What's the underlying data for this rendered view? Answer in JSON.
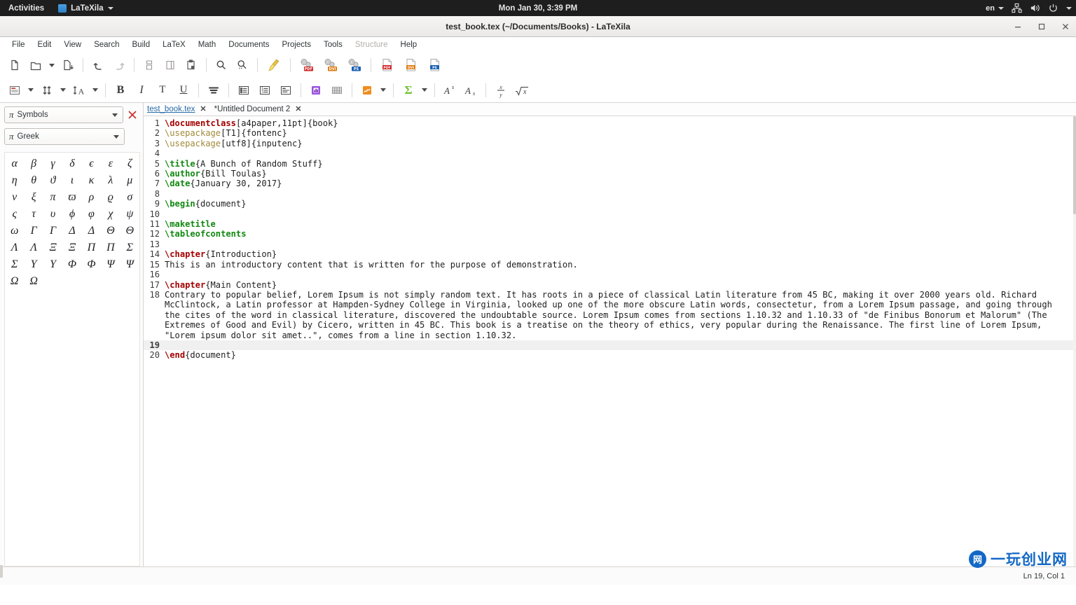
{
  "desktop": {
    "activities_label": "Activities",
    "app_name": "LaTeXila",
    "clock": "Mon Jan 30,  3:39 PM",
    "language": "en",
    "icons": [
      "network-icon",
      "volume-icon",
      "power-icon"
    ]
  },
  "window": {
    "title": "test_book.tex (~/Documents/Books) - LaTeXila",
    "controls": [
      "minimize-button",
      "maximize-button",
      "close-button"
    ]
  },
  "menubar": {
    "items": [
      {
        "label": "File",
        "disabled": false
      },
      {
        "label": "Edit",
        "disabled": false
      },
      {
        "label": "View",
        "disabled": false
      },
      {
        "label": "Search",
        "disabled": false
      },
      {
        "label": "Build",
        "disabled": false
      },
      {
        "label": "LaTeX",
        "disabled": false
      },
      {
        "label": "Math",
        "disabled": false
      },
      {
        "label": "Documents",
        "disabled": false
      },
      {
        "label": "Projects",
        "disabled": false
      },
      {
        "label": "Tools",
        "disabled": false
      },
      {
        "label": "Structure",
        "disabled": true
      },
      {
        "label": "Help",
        "disabled": false
      }
    ]
  },
  "toolbar_main": {
    "groups": [
      [
        "new-document-icon",
        "open-file-icon",
        "open-recent-dropdown-icon",
        "save-file-icon"
      ],
      [
        "undo-icon",
        "redo-icon"
      ],
      [
        "cut-icon",
        "copy-icon",
        "paste-icon"
      ],
      [
        "find-icon",
        "find-replace-icon"
      ],
      [
        "clean-build-files-icon"
      ],
      [
        "build-to-pdf-icon",
        "build-to-dvi-icon",
        "build-to-ps-icon"
      ],
      [
        "view-pdf-icon",
        "view-dvi-icon",
        "view-ps-icon"
      ]
    ]
  },
  "toolbar_edit": {
    "groups": [
      [
        "sectioning-icon",
        "sectioning-dropdown-icon",
        "size-icon",
        "size-dropdown-icon",
        "font-size-icon",
        "font-size-dropdown-icon"
      ],
      [
        "bold-icon",
        "italic-icon",
        "typewriter-icon",
        "underline-icon"
      ],
      [
        "paragraph-icon"
      ],
      [
        "itemize-list-icon",
        "enumerate-list-icon",
        "description-list-icon"
      ],
      [
        "figure-environment-icon",
        "table-environment-icon"
      ],
      [
        "graphics-icon",
        "graphics-dropdown-icon"
      ],
      [
        "math-environment-icon",
        "math-dropdown-icon"
      ],
      [
        "superscript-icon",
        "subscript-icon"
      ],
      [
        "fraction-icon",
        "square-root-icon"
      ]
    ],
    "labels": {
      "bold": "B",
      "italic": "I",
      "typewriter": "T",
      "underline": "U",
      "superscript": "A",
      "subscript": "A",
      "sigma": "Σ",
      "fraction_num": "x",
      "fraction_den": "y",
      "sqrt": "√x"
    }
  },
  "side_panel": {
    "category_combo": {
      "icon": "pi-icon",
      "value": "Symbols"
    },
    "subcategory_combo": {
      "icon": "pi-icon",
      "value": "Greek"
    },
    "close_label": "✕",
    "symbols": [
      "α",
      "β",
      "γ",
      "δ",
      "ϵ",
      "ε",
      "ζ",
      "η",
      "θ",
      "ϑ",
      "ι",
      "κ",
      "λ",
      "μ",
      "ν",
      "ξ",
      "π",
      "ϖ",
      "ρ",
      "ϱ",
      "σ",
      "ς",
      "τ",
      "υ",
      "ϕ",
      "φ",
      "χ",
      "ψ",
      "ω",
      "Γ",
      "Γ",
      "Δ",
      "Δ",
      "Θ",
      "Θ",
      "Λ",
      "Λ",
      "Ξ",
      "Ξ",
      "Π",
      "Π",
      "Σ",
      "Σ",
      "Υ",
      "Υ",
      "Φ",
      "Φ",
      "Ψ",
      "Ψ",
      "Ω",
      "Ω"
    ]
  },
  "tabs": [
    {
      "label": "test_book.tex",
      "active": true,
      "modified": false,
      "close": "✕"
    },
    {
      "label": "*Untitled Document 2",
      "active": false,
      "modified": true,
      "close": "✕"
    }
  ],
  "editor": {
    "lines": [
      {
        "n": "1",
        "current": false,
        "parts": [
          {
            "t": "\\documentclass",
            "c": "k-cmd"
          },
          {
            "t": "[a4paper,11pt]{book}",
            "c": "k-plain"
          }
        ]
      },
      {
        "n": "2",
        "current": false,
        "parts": [
          {
            "t": "\\usepackage",
            "c": "k-pkg"
          },
          {
            "t": "[T1]{fontenc}",
            "c": "k-plain"
          }
        ]
      },
      {
        "n": "3",
        "current": false,
        "parts": [
          {
            "t": "\\usepackage",
            "c": "k-pkg"
          },
          {
            "t": "[utf8]{inputenc}",
            "c": "k-plain"
          }
        ]
      },
      {
        "n": "4",
        "current": false,
        "parts": [
          {
            "t": "",
            "c": "k-plain"
          }
        ]
      },
      {
        "n": "5",
        "current": false,
        "parts": [
          {
            "t": "\\title",
            "c": "k-meta"
          },
          {
            "t": "{A Bunch of Random Stuff}",
            "c": "k-plain"
          }
        ]
      },
      {
        "n": "6",
        "current": false,
        "parts": [
          {
            "t": "\\author",
            "c": "k-meta"
          },
          {
            "t": "{Bill Toulas}",
            "c": "k-plain"
          }
        ]
      },
      {
        "n": "7",
        "current": false,
        "parts": [
          {
            "t": "\\date",
            "c": "k-meta"
          },
          {
            "t": "{January 30, 2017}",
            "c": "k-plain"
          }
        ]
      },
      {
        "n": "8",
        "current": false,
        "parts": [
          {
            "t": "",
            "c": "k-plain"
          }
        ]
      },
      {
        "n": "9",
        "current": false,
        "parts": [
          {
            "t": "\\begin",
            "c": "k-meta"
          },
          {
            "t": "{document}",
            "c": "k-plain"
          }
        ]
      },
      {
        "n": "10",
        "current": false,
        "parts": [
          {
            "t": "",
            "c": "k-plain"
          }
        ]
      },
      {
        "n": "11",
        "current": false,
        "parts": [
          {
            "t": "\\maketitle",
            "c": "k-meta"
          }
        ]
      },
      {
        "n": "12",
        "current": false,
        "parts": [
          {
            "t": "\\tableofcontents",
            "c": "k-meta"
          }
        ]
      },
      {
        "n": "13",
        "current": false,
        "parts": [
          {
            "t": "",
            "c": "k-plain"
          }
        ]
      },
      {
        "n": "14",
        "current": false,
        "parts": [
          {
            "t": "\\chapter",
            "c": "k-cmd"
          },
          {
            "t": "{Introduction}",
            "c": "k-plain"
          }
        ]
      },
      {
        "n": "15",
        "current": false,
        "parts": [
          {
            "t": "This is an introductory content that is written for the purpose of demonstration.",
            "c": "k-plain"
          }
        ]
      },
      {
        "n": "16",
        "current": false,
        "parts": [
          {
            "t": "",
            "c": "k-plain"
          }
        ]
      },
      {
        "n": "17",
        "current": false,
        "parts": [
          {
            "t": "\\chapter",
            "c": "k-cmd"
          },
          {
            "t": "{Main Content}",
            "c": "k-plain"
          }
        ]
      },
      {
        "n": "18",
        "current": false,
        "parts": [
          {
            "t": "Contrary to popular belief, Lorem Ipsum is not simply random text. It has roots in a piece of classical Latin literature from 45 BC, making it over 2000 years old. Richard McClintock, a Latin professor at Hampden-Sydney College in Virginia, looked up one of the more obscure Latin words, consectetur, from a Lorem Ipsum passage, and going through the cites of the word in classical literature, discovered the undoubtable source. Lorem Ipsum comes from sections 1.10.32 and 1.10.33 of \"de Finibus Bonorum et Malorum\" (The Extremes of Good and Evil) by Cicero, written in 45 BC. This book is a treatise on the theory of ethics, very popular during the Renaissance. The first line of Lorem Ipsum, \"Lorem ipsum dolor sit amet..\", comes from a line in section 1.10.32.",
            "c": "k-plain"
          }
        ]
      },
      {
        "n": "19",
        "current": true,
        "parts": [
          {
            "t": "",
            "c": "k-plain"
          }
        ]
      },
      {
        "n": "20",
        "current": false,
        "parts": [
          {
            "t": "\\end",
            "c": "k-cmd"
          },
          {
            "t": "{document}",
            "c": "k-plain"
          }
        ]
      }
    ]
  },
  "statusbar": {
    "cursor_position": "Ln 19, Col 1"
  },
  "watermark": {
    "logo_glyph": "网",
    "text": "一玩创业网",
    "color": "#1368c6"
  },
  "colors": {
    "gnome_bar": "#1e1e1e",
    "titlebar": "#f6f5f4",
    "accent_tab": "#2a6ca8",
    "cmd_red": "#a40000",
    "meta_green": "#118811",
    "pkg_olive": "#a08a38"
  }
}
